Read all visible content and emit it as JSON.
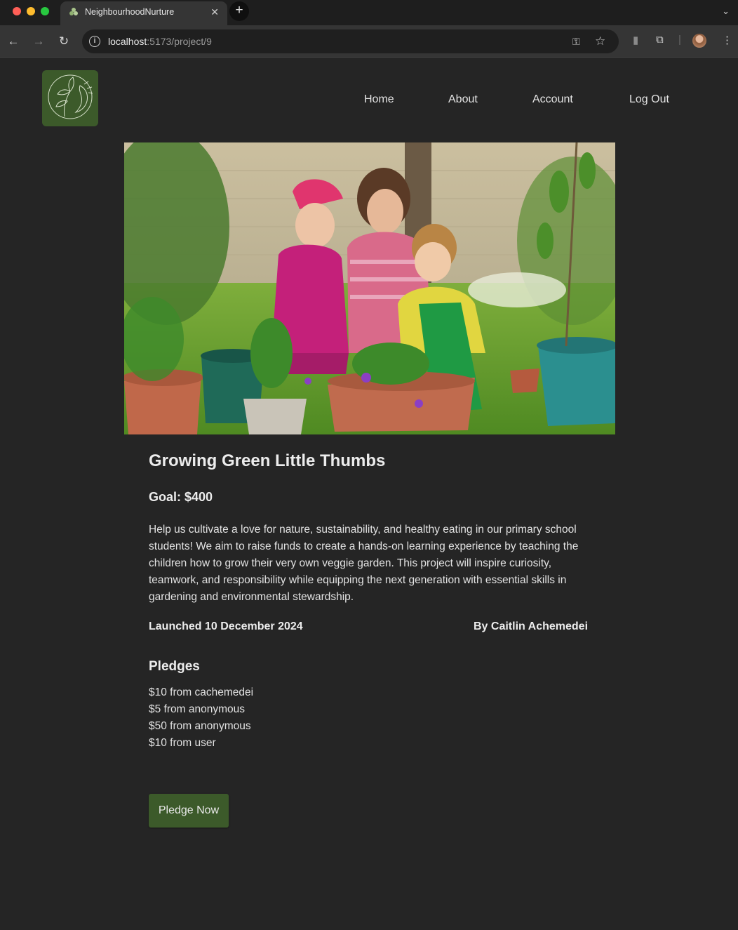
{
  "browser": {
    "tab_title": "NeighbourhoodNurture",
    "url_host": "localhost",
    "url_path": ":5173/project/9"
  },
  "nav": {
    "items": [
      {
        "label": "Home"
      },
      {
        "label": "About"
      },
      {
        "label": "Account"
      },
      {
        "label": "Log Out"
      }
    ]
  },
  "project": {
    "title": "Growing Green Little Thumbs",
    "goal": "Goal: $400",
    "description": "Help us cultivate a love for nature, sustainability, and healthy eating in our primary school students! We aim to raise funds to create a hands-on learning experience by teaching the children how to grow their very own veggie garden. This project will inspire curiosity, teamwork, and responsibility while equipping the next generation with essential skills in gardening and environmental stewardship.",
    "launched": "Launched 10 December 2024",
    "owner": "By Caitlin Achemedei"
  },
  "pledges": {
    "heading": "Pledges",
    "items": [
      "$10 from cachemedei",
      "$5 from anonymous",
      "$50 from anonymous",
      "$10 from user"
    ]
  },
  "actions": {
    "pledge_button": "Pledge Now"
  },
  "colors": {
    "background": "#252525",
    "brand_green": "#3c5a2a"
  },
  "icons": {
    "logo": "flower-woman-logo-icon",
    "hero": "children-gardening-photo"
  }
}
